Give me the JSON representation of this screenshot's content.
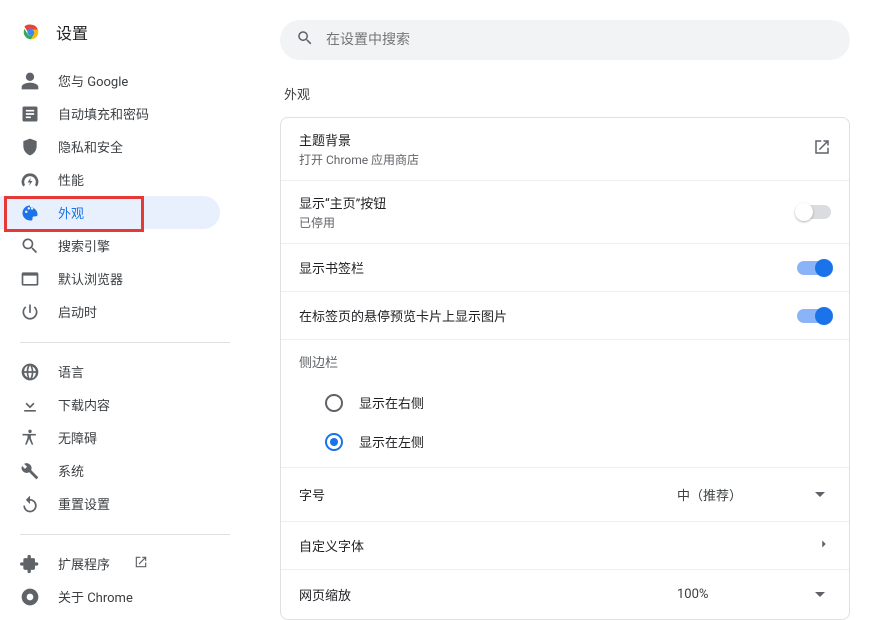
{
  "header": {
    "title": "设置"
  },
  "search": {
    "placeholder": "在设置中搜索"
  },
  "sidebar": {
    "items": [
      {
        "id": "you-and-google",
        "label": "您与 Google",
        "icon": "person"
      },
      {
        "id": "autofill",
        "label": "自动填充和密码",
        "icon": "autofill"
      },
      {
        "id": "privacy",
        "label": "隐私和安全",
        "icon": "shield"
      },
      {
        "id": "performance",
        "label": "性能",
        "icon": "speed"
      },
      {
        "id": "appearance",
        "label": "外观",
        "icon": "palette",
        "active": true
      },
      {
        "id": "search-engine",
        "label": "搜索引擎",
        "icon": "search"
      },
      {
        "id": "default-browser",
        "label": "默认浏览器",
        "icon": "browser"
      },
      {
        "id": "startup",
        "label": "启动时",
        "icon": "power"
      }
    ],
    "items2": [
      {
        "id": "language",
        "label": "语言",
        "icon": "globe"
      },
      {
        "id": "downloads",
        "label": "下载内容",
        "icon": "download"
      },
      {
        "id": "accessibility",
        "label": "无障碍",
        "icon": "accessibility"
      },
      {
        "id": "system",
        "label": "系统",
        "icon": "wrench"
      },
      {
        "id": "reset",
        "label": "重置设置",
        "icon": "reset"
      }
    ],
    "items3": [
      {
        "id": "extensions",
        "label": "扩展程序",
        "icon": "extension",
        "external": true
      },
      {
        "id": "about",
        "label": "关于 Chrome",
        "icon": "chrome"
      }
    ]
  },
  "main": {
    "section_title": "外观",
    "theme": {
      "title": "主题背景",
      "sub": "打开 Chrome 应用商店"
    },
    "home_button": {
      "title": "显示“主页”按钮",
      "sub": "已停用",
      "enabled": false
    },
    "bookmarks_bar": {
      "title": "显示书签栏",
      "enabled": true
    },
    "hover_card_images": {
      "title": "在标签页的悬停预览卡片上显示图片",
      "enabled": true
    },
    "side_panel": {
      "title": "侧边栏",
      "options": [
        {
          "label": "显示在右侧",
          "value": "right",
          "checked": false
        },
        {
          "label": "显示在左侧",
          "value": "left",
          "checked": true
        }
      ]
    },
    "font_size": {
      "title": "字号",
      "value": "中（推荐）"
    },
    "custom_fonts": {
      "title": "自定义字体"
    },
    "page_zoom": {
      "title": "网页缩放",
      "value": "100%"
    }
  }
}
